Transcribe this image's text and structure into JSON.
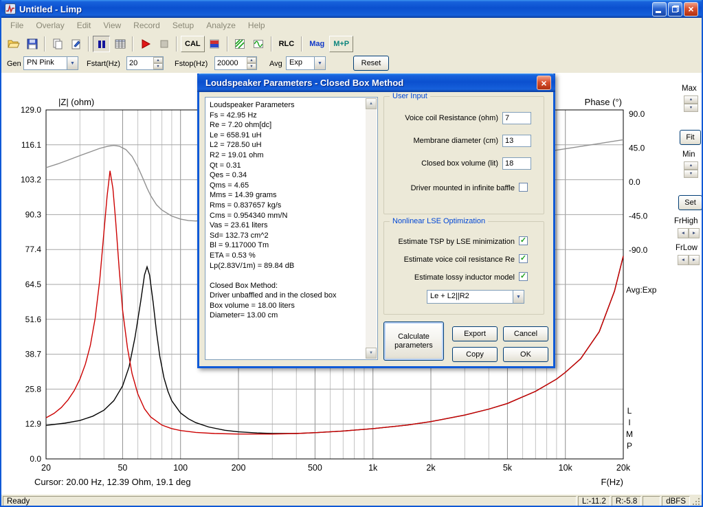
{
  "window": {
    "title": "Untitled - Limp"
  },
  "icons": {
    "close": "×",
    "up_arrow": "▲",
    "down_arrow": "▼",
    "left_arrow": "◄",
    "right_arrow": "►",
    "dropdown_arrow": "▼",
    "check": "✓"
  },
  "menu": {
    "items": [
      "File",
      "Overlay",
      "Edit",
      "View",
      "Record",
      "Setup",
      "Analyze",
      "Help"
    ]
  },
  "toolbar": {
    "cal": "CAL",
    "rlc": "RLC",
    "mag": "Mag",
    "mp": "M+P"
  },
  "controls": {
    "gen_label": "Gen",
    "gen_value": "PN Pink",
    "fstart_label": "Fstart(Hz)",
    "fstart_value": "20",
    "fstop_label": "Fstop(Hz)",
    "fstop_value": "20000",
    "avg_label": "Avg",
    "avg_value": "Exp",
    "reset_label": "Reset"
  },
  "right_panel": {
    "max": "Max",
    "fit": "Fit",
    "min": "Min",
    "set": "Set",
    "frhigh": "FrHigh",
    "frlow": "FrLow",
    "avg_text": "Avg:Exp",
    "limp": [
      "L",
      "I",
      "M",
      "P"
    ]
  },
  "chart_data": {
    "type": "line",
    "title_left": "|Z| (ohm)",
    "title_right": "Phase (°)",
    "xlabel": "F(Hz)",
    "x_scale": "log",
    "x_range": [
      20,
      20000
    ],
    "x_ticks": [
      {
        "f": 20,
        "label": "20"
      },
      {
        "f": 50,
        "label": "50"
      },
      {
        "f": 100,
        "label": "100"
      },
      {
        "f": 200,
        "label": "200"
      },
      {
        "f": 500,
        "label": "500"
      },
      {
        "f": 1000,
        "label": "1k"
      },
      {
        "f": 2000,
        "label": "2k"
      },
      {
        "f": 5000,
        "label": "5k"
      },
      {
        "f": 10000,
        "label": "10k"
      },
      {
        "f": 20000,
        "label": "20k"
      }
    ],
    "y_left": {
      "range": [
        0,
        129
      ],
      "ticks": [
        "129.0",
        "116.1",
        "103.2",
        "90.3",
        "77.4",
        "64.5",
        "51.6",
        "38.7",
        "25.8",
        "12.9",
        "0.0"
      ]
    },
    "y_right": {
      "range_deg": [
        -90,
        90
      ],
      "ticks": [
        "90.0",
        "45.0",
        "0.0",
        "-45.0",
        "-90.0"
      ]
    },
    "grid": true,
    "cursor_text": "Cursor: 20.00 Hz, 12.39 Ohm, 19.1 deg",
    "series": [
      {
        "name": "phase",
        "unit": "deg",
        "color": "#909090",
        "points": [
          [
            20,
            19.1
          ],
          [
            23,
            24
          ],
          [
            26,
            29
          ],
          [
            30,
            35
          ],
          [
            34,
            40
          ],
          [
            38,
            44.5
          ],
          [
            42,
            47.5
          ],
          [
            45,
            48.5
          ],
          [
            48,
            47.5
          ],
          [
            52,
            43
          ],
          [
            56,
            34
          ],
          [
            60,
            20
          ],
          [
            64,
            4
          ],
          [
            67,
            -8
          ],
          [
            70,
            -18
          ],
          [
            75,
            -30
          ],
          [
            80,
            -37
          ],
          [
            90,
            -45
          ],
          [
            100,
            -49
          ],
          [
            110,
            -51
          ],
          [
            120,
            -51.5
          ],
          [
            140,
            -50
          ],
          [
            170,
            -47
          ],
          [
            200,
            -43.5
          ],
          [
            250,
            -38
          ],
          [
            300,
            -33
          ],
          [
            400,
            -25
          ],
          [
            500,
            -19
          ],
          [
            700,
            -10
          ],
          [
            1000,
            -1
          ],
          [
            1500,
            8
          ],
          [
            2000,
            14
          ],
          [
            3000,
            22
          ],
          [
            5000,
            32
          ],
          [
            7000,
            38
          ],
          [
            10000,
            44
          ],
          [
            15000,
            51
          ],
          [
            20000,
            56
          ]
        ]
      },
      {
        "name": "impedance-closed-box",
        "unit": "ohm",
        "color": "#000000",
        "points": [
          [
            20,
            12.4
          ],
          [
            25,
            13.2
          ],
          [
            30,
            14.2
          ],
          [
            35,
            15.8
          ],
          [
            40,
            18
          ],
          [
            45,
            21.5
          ],
          [
            50,
            27
          ],
          [
            54,
            34
          ],
          [
            58,
            45
          ],
          [
            62,
            58
          ],
          [
            65,
            68
          ],
          [
            67,
            71
          ],
          [
            69,
            68
          ],
          [
            72,
            58
          ],
          [
            75,
            47
          ],
          [
            78,
            38
          ],
          [
            82,
            30
          ],
          [
            86,
            25
          ],
          [
            90,
            21.5
          ],
          [
            100,
            17
          ],
          [
            110,
            14.8
          ],
          [
            120,
            13.4
          ],
          [
            140,
            11.8
          ],
          [
            170,
            10.6
          ],
          [
            200,
            10
          ],
          [
            250,
            9.6
          ],
          [
            300,
            9.4
          ],
          [
            400,
            9.4
          ],
          [
            500,
            9.7
          ],
          [
            700,
            10.3
          ],
          [
            1000,
            11.2
          ],
          [
            1500,
            12.5
          ],
          [
            2000,
            13.8
          ],
          [
            3000,
            16.2
          ],
          [
            4000,
            18.4
          ],
          [
            5000,
            20.5
          ],
          [
            7000,
            25
          ],
          [
            9000,
            29.5
          ],
          [
            10000,
            32
          ],
          [
            12000,
            37
          ],
          [
            15000,
            47
          ],
          [
            18000,
            62
          ],
          [
            20000,
            75
          ]
        ]
      },
      {
        "name": "impedance-free-air",
        "unit": "ohm",
        "color": "#cc0000",
        "points": [
          [
            20,
            15.2
          ],
          [
            22,
            16.8
          ],
          [
            24,
            19
          ],
          [
            26,
            21.8
          ],
          [
            28,
            25.2
          ],
          [
            30,
            29.5
          ],
          [
            32,
            35
          ],
          [
            34,
            42
          ],
          [
            36,
            52
          ],
          [
            38,
            66
          ],
          [
            40,
            84
          ],
          [
            41.5,
            97
          ],
          [
            43,
            106.5
          ],
          [
            44.5,
            100
          ],
          [
            46,
            88
          ],
          [
            48,
            70
          ],
          [
            50,
            55
          ],
          [
            53,
            41
          ],
          [
            56,
            31.5
          ],
          [
            60,
            24
          ],
          [
            65,
            18.5
          ],
          [
            70,
            15.5
          ],
          [
            80,
            12.5
          ],
          [
            90,
            11.2
          ],
          [
            100,
            10.5
          ],
          [
            120,
            9.8
          ],
          [
            150,
            9.4
          ],
          [
            200,
            9.2
          ],
          [
            300,
            9.2
          ],
          [
            400,
            9.4
          ],
          [
            500,
            9.7
          ],
          [
            700,
            10.3
          ],
          [
            1000,
            11.2
          ],
          [
            1500,
            12.5
          ],
          [
            2000,
            13.8
          ],
          [
            3000,
            16.2
          ],
          [
            4000,
            18.4
          ],
          [
            5000,
            20.5
          ],
          [
            7000,
            25
          ],
          [
            9000,
            29.5
          ],
          [
            10000,
            32
          ],
          [
            12000,
            37
          ],
          [
            15000,
            47
          ],
          [
            18000,
            62
          ],
          [
            20000,
            75
          ]
        ]
      }
    ]
  },
  "dialog": {
    "title": "Loudspeaker Parameters - Closed Box Method",
    "params_text": [
      "Loudspeaker Parameters",
      "Fs = 42.95 Hz",
      "Re = 7.20 ohm[dc]",
      "Le = 658.91 uH",
      "L2 = 728.50 uH",
      "R2 = 19.01 ohm",
      "Qt = 0.31",
      "Qes = 0.34",
      "Qms = 4.65",
      "Mms = 14.39 grams",
      "Rms = 0.837657 kg/s",
      "Cms = 0.954340 mm/N",
      "Vas = 23.61 liters",
      "Sd= 132.73 cm^2",
      "Bl = 9.117000 Tm",
      "ETA = 0.53 %",
      "Lp(2.83V/1m) = 89.84 dB",
      "",
      "Closed Box Method:",
      "Driver unbaffled and in the closed box",
      "Box volume = 18.00 liters",
      "Diameter= 13.00 cm"
    ],
    "user_input": {
      "title": "User Input",
      "fields": [
        {
          "label": "Voice coil Resistance (ohm)",
          "value": "7"
        },
        {
          "label": "Membrane diameter (cm)",
          "value": "13"
        },
        {
          "label": "Closed box volume (lit)",
          "value": "18"
        }
      ],
      "baffle_label": "Driver mounted in infinite baffle",
      "baffle_checked": false
    },
    "lse": {
      "title": "Nonlinear LSE Optimization",
      "options": [
        {
          "label": "Estimate TSP by LSE minimization",
          "checked": true
        },
        {
          "label": "Estimate voice coil resistance Re",
          "checked": true
        },
        {
          "label": "Estimate lossy inductor model",
          "checked": true
        }
      ],
      "model_value": "Le + L2||R2"
    },
    "buttons": {
      "calculate": "Calculate parameters",
      "export": "Export",
      "cancel": "Cancel",
      "copy": "Copy",
      "ok": "OK"
    }
  },
  "status": {
    "ready": "Ready",
    "l": "L:-11.2",
    "r": "R:-5.8",
    "unit": "dBFS"
  }
}
